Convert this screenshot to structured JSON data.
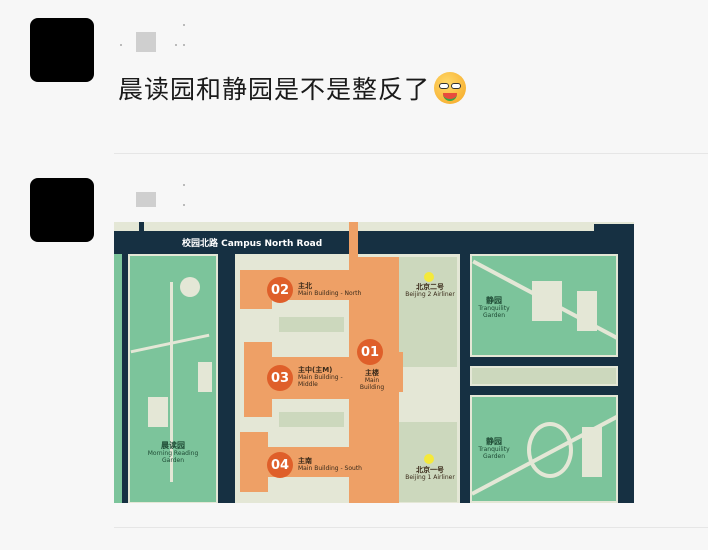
{
  "comments": [
    {
      "avatar": "avatar-black",
      "text": "晨读园和静园是不是整反了",
      "emoji": "watermelon-eating-emoji"
    },
    {
      "avatar": "avatar-black",
      "image": "campus-map"
    }
  ],
  "map": {
    "road": "校园北路  Campus North Road",
    "buildings": [
      {
        "num": "01",
        "cn": "主楼",
        "en": "Main Building"
      },
      {
        "num": "02",
        "cn": "主北",
        "en": "Main Building - North"
      },
      {
        "num": "03",
        "cn": "主中(主M)",
        "en": "Main Building - Middle"
      },
      {
        "num": "04",
        "cn": "主南",
        "en": "Main Building - South"
      }
    ],
    "landmarks": [
      {
        "cn": "北京二号",
        "en": "Beijing 2 Airliner"
      },
      {
        "cn": "北京一号",
        "en": "Beijing 1 Airliner"
      }
    ],
    "gardens": [
      {
        "cn": "晨读园",
        "en": "Morning Reading Garden"
      },
      {
        "cn": "静园",
        "en": "Tranquility Garden"
      },
      {
        "cn": "静园",
        "en": "Tranquility Garden"
      }
    ],
    "colors": {
      "road": "#163042",
      "garden": "#7cc49b",
      "building": "#eea066",
      "badge": "#df5f2a"
    }
  }
}
